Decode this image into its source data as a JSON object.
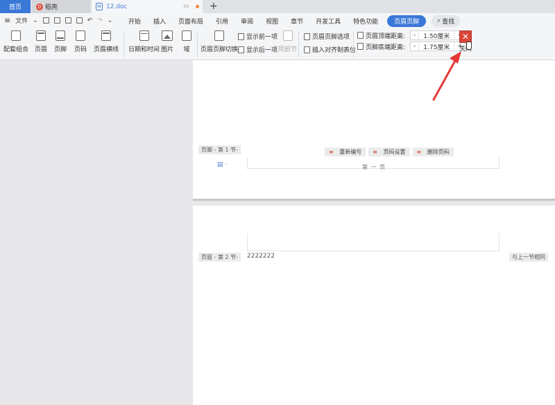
{
  "tabs": {
    "home": "首页",
    "daoke": "稻壳",
    "doc": "12.doc",
    "new_tab": "+"
  },
  "menu": {
    "file": "文件",
    "tabs": [
      "开始",
      "插入",
      "页面布局",
      "引用",
      "审阅",
      "视图",
      "章节",
      "开发工具",
      "特色功能"
    ],
    "active_tab": "页眉页脚",
    "search": "查找"
  },
  "toolbar": {
    "config": "配套组合",
    "header": "页眉",
    "footer": "页脚",
    "page_number": "页码",
    "header_line": "页眉横线",
    "datetime": "日期和时间",
    "picture": "图片",
    "field": "域",
    "switch": "页眉页脚切换",
    "show_prev": "显示前一项",
    "show_next": "显示后一项",
    "same_as_prev": "同前节",
    "options": "页眉页脚选项",
    "insert_tab": "插入对齐制表位",
    "top_distance_label": "页眉顶端距离:",
    "top_distance_value": "1.50厘米",
    "bottom_distance_label": "页脚底端距离:",
    "bottom_distance_value": "1.75厘米",
    "minus": "-",
    "plus": "+",
    "close_label": "关闭",
    "close_symbol": "✕"
  },
  "page1": {
    "footer_tag": "页脚 - 第 1 节-",
    "renumber": "重新编号",
    "page_settings": "页码设置",
    "delete_page_number": "删除页码",
    "footer_text": "第 一 页",
    "bullet": "≡"
  },
  "page2": {
    "header_tag": "页眉 - 第 2 节-",
    "header_text": "2222222",
    "same_as_prev": "与上一节相同"
  },
  "colors": {
    "accent": "#3a78d8",
    "close": "#d9463a",
    "arrow": "#e53935"
  }
}
